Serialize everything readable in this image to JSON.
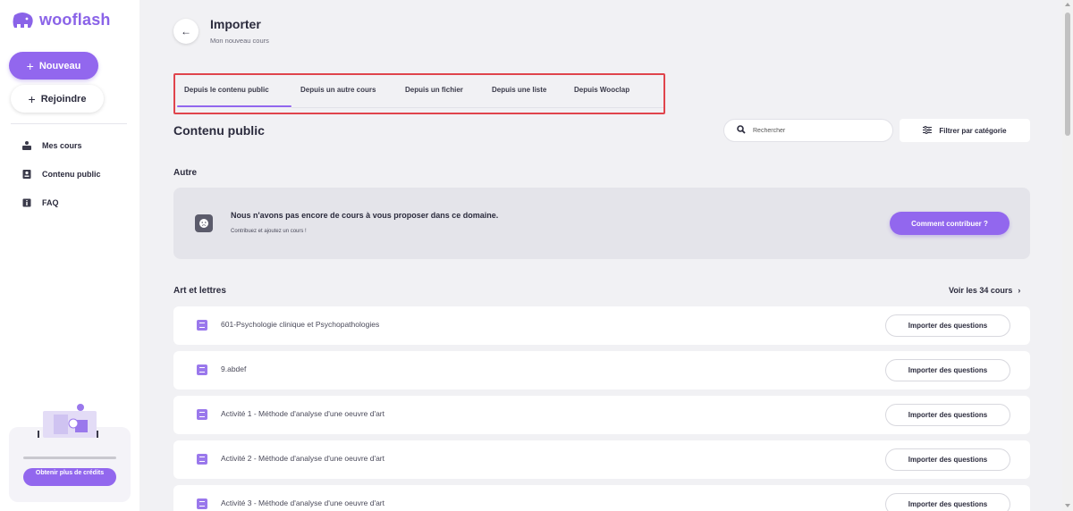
{
  "app": {
    "name": "wooflash",
    "brand_color": "#9267ee"
  },
  "sidebar": {
    "new_button": "Nouveau",
    "join_button": "Rejoindre",
    "items": [
      {
        "label": "Mes cours",
        "icon": "courses-icon"
      },
      {
        "label": "Contenu public",
        "icon": "public-content-icon"
      },
      {
        "label": "FAQ",
        "icon": "info-icon"
      }
    ],
    "credits_button": "Obtenir plus de crédits"
  },
  "header": {
    "title": "Importer",
    "subtitle": "Mon nouveau cours"
  },
  "tabs": [
    {
      "label": "Depuis le contenu public",
      "active": true
    },
    {
      "label": "Depuis un autre cours",
      "active": false
    },
    {
      "label": "Depuis un fichier",
      "active": false
    },
    {
      "label": "Depuis une liste",
      "active": false
    },
    {
      "label": "Depuis Wooclap",
      "active": false
    }
  ],
  "content": {
    "heading": "Contenu public",
    "search_placeholder": "Rechercher",
    "filter_label": "Filtrer par catégorie",
    "autre": {
      "heading": "Autre",
      "empty_title": "Nous n'avons pas encore de cours à vous proposer dans ce domaine.",
      "empty_subtitle": "Contribuez et ajoutez un cours !",
      "contribute_button": "Comment contribuer ?"
    },
    "category": {
      "heading": "Art et lettres",
      "see_all": "Voir les 34 cours",
      "courses": [
        {
          "name": "601-Psychologie clinique et Psychopathologies",
          "action": "Importer des questions"
        },
        {
          "name": "9.abdef",
          "action": "Importer des questions"
        },
        {
          "name": "Activité 1 - Méthode d'analyse d'une oeuvre d'art",
          "action": "Importer des questions"
        },
        {
          "name": "Activité 2 - Méthode d'analyse d'une oeuvre d'art",
          "action": "Importer des questions"
        },
        {
          "name": "Activité 3 - Méthode d'analyse d'une oeuvre d'art",
          "action": "Importer des questions"
        }
      ]
    }
  }
}
